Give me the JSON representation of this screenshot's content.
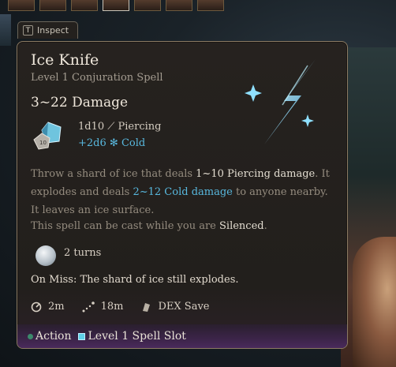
{
  "tooltip": {
    "inspect_key": "T",
    "inspect_label": "Inspect",
    "title": "Ice Knife",
    "subtitle": "Level 1 Conjuration Spell",
    "damage_range": "3~22 Damage",
    "primary_damage_dice": "1d10",
    "primary_damage_type": "Piercing",
    "secondary_damage_dice": "+2d6",
    "secondary_damage_type": "Cold",
    "description": {
      "p1": "Throw a shard of ice that deals ",
      "p1_hl": "1~10 Piercing damage",
      "p2": ". It explodes and deals ",
      "p2_hl": "2~12 Cold damage",
      "p3": " to anyone nearby. It leaves an ice surface."
    },
    "silenced_prefix": "This spell can be cast while you are ",
    "silenced_word": "Silenced",
    "silenced_suffix": ".",
    "duration": "2 turns",
    "on_miss": "On Miss: The shard of ice still explodes.",
    "aoe_radius": "2m",
    "range": "18m",
    "save": "DEX Save",
    "cost_action": "Action",
    "cost_slot": "Level 1 Spell Slot"
  },
  "colors": {
    "cold_accent": "#58b8de",
    "action_dot": "#3c8a6c",
    "spell_slot": "#5fd0e8",
    "border": "#8a7a62"
  },
  "icons": [
    "dice-icon",
    "dagger-icon",
    "snowflake-icon",
    "moon-icon",
    "radius-icon",
    "range-icon",
    "save-icon",
    "ice-shard-icon"
  ]
}
